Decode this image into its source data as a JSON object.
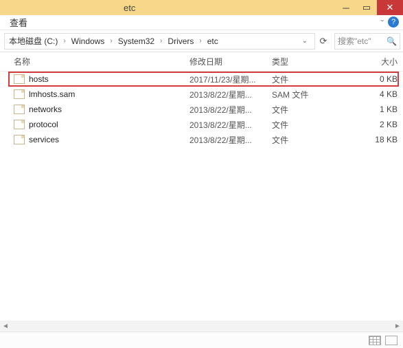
{
  "window": {
    "title": "etc"
  },
  "menu": {
    "view": "查看"
  },
  "address": {
    "segments": [
      "本地磁盘 (C:)",
      "Windows",
      "System32",
      "Drivers",
      "etc"
    ]
  },
  "search": {
    "placeholder": "搜索\"etc\""
  },
  "columns": {
    "name": "名称",
    "date": "修改日期",
    "type": "类型",
    "size": "大小"
  },
  "files": [
    {
      "name": "hosts",
      "date": "2017/11/23/星期...",
      "type": "文件",
      "size": "0 KB"
    },
    {
      "name": "lmhosts.sam",
      "date": "2013/8/22/星期...",
      "type": "SAM 文件",
      "size": "4 KB"
    },
    {
      "name": "networks",
      "date": "2013/8/22/星期...",
      "type": "文件",
      "size": "1 KB"
    },
    {
      "name": "protocol",
      "date": "2013/8/22/星期...",
      "type": "文件",
      "size": "2 KB"
    },
    {
      "name": "services",
      "date": "2013/8/22/星期...",
      "type": "文件",
      "size": "18 KB"
    }
  ],
  "highlighted_index": 0
}
